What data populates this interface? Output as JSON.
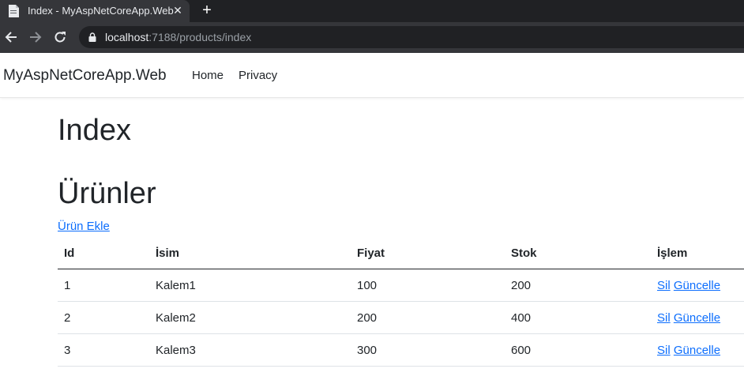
{
  "browser": {
    "tab_title": "Index - MyAspNetCoreApp.Web",
    "close_glyph": "✕",
    "newtab_glyph": "+",
    "url_host": "localhost",
    "url_rest": ":7188/products/index",
    "icons": [
      "document-icon",
      "back-icon",
      "forward-icon",
      "reload-icon",
      "lock-icon"
    ]
  },
  "navbar": {
    "brand": "MyAspNetCoreApp.Web",
    "links": [
      {
        "label": "Home"
      },
      {
        "label": "Privacy"
      }
    ]
  },
  "main": {
    "title": "Index",
    "heading": "Ürünler",
    "add_link": "Ürün Ekle",
    "table": {
      "headers": [
        "Id",
        "İsim",
        "Fiyat",
        "Stok",
        "İşlem"
      ],
      "rows": [
        {
          "id": "1",
          "name": "Kalem1",
          "price": "100",
          "stock": "200",
          "delete": "Sil",
          "update": "Güncelle"
        },
        {
          "id": "2",
          "name": "Kalem2",
          "price": "200",
          "stock": "400",
          "delete": "Sil",
          "update": "Güncelle"
        },
        {
          "id": "3",
          "name": "Kalem3",
          "price": "300",
          "stock": "600",
          "delete": "Sil",
          "update": "Güncelle"
        }
      ]
    }
  },
  "colors": {
    "link": "#0d6efd",
    "text": "#212529",
    "chrome_dark": "#202124",
    "chrome_tab": "#35363a"
  }
}
